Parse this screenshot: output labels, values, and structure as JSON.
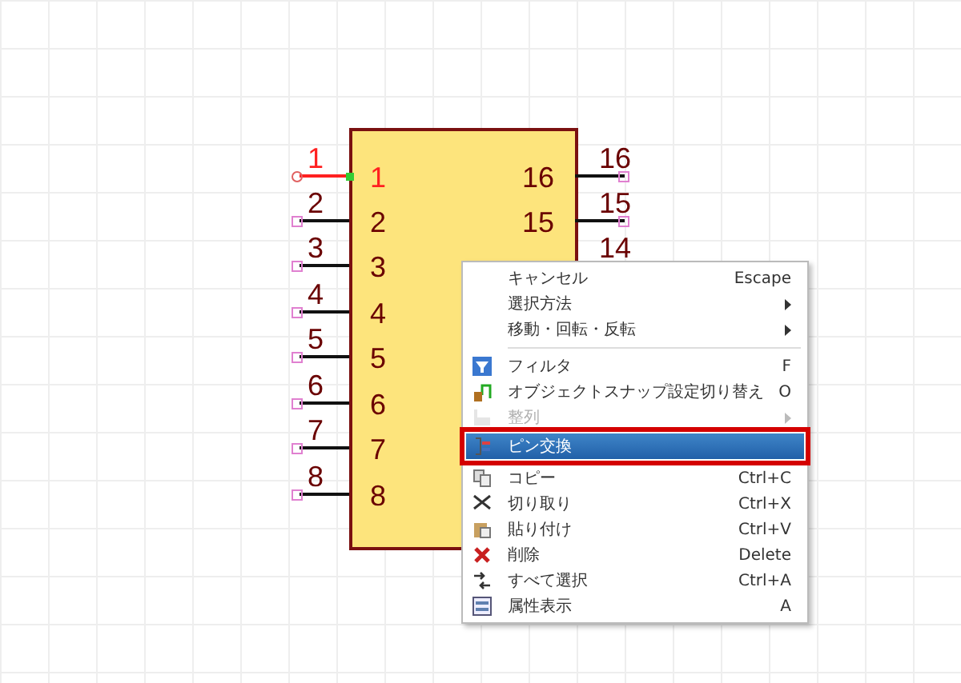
{
  "symbol": {
    "left_pins": [
      {
        "number": "1",
        "label": "1",
        "selected": true
      },
      {
        "number": "2",
        "label": "2",
        "selected": false
      },
      {
        "number": "3",
        "label": "3",
        "selected": false
      },
      {
        "number": "4",
        "label": "4",
        "selected": false
      },
      {
        "number": "5",
        "label": "5",
        "selected": false
      },
      {
        "number": "6",
        "label": "6",
        "selected": false
      },
      {
        "number": "7",
        "label": "7",
        "selected": false
      },
      {
        "number": "8",
        "label": "8",
        "selected": false
      }
    ],
    "right_pins": [
      {
        "number": "16",
        "label": "16"
      },
      {
        "number": "15",
        "label": "15"
      },
      {
        "number": "14"
      }
    ]
  },
  "context_menu": {
    "items": [
      {
        "kind": "item",
        "label": "キャンセル",
        "shortcut": "Escape",
        "submenu": false,
        "disabled": false,
        "selected": false
      },
      {
        "kind": "item",
        "label": "選択方法",
        "submenu": true,
        "disabled": false,
        "selected": false
      },
      {
        "kind": "item",
        "label": "移動・回転・反転",
        "submenu": true,
        "disabled": false,
        "selected": false
      },
      {
        "kind": "separator"
      },
      {
        "kind": "item",
        "label": "フィルタ",
        "shortcut": "F",
        "submenu": false,
        "disabled": false,
        "selected": false
      },
      {
        "kind": "item",
        "label": "オブジェクトスナップ設定切り替え",
        "shortcut": "O",
        "submenu": false,
        "disabled": false,
        "selected": false
      },
      {
        "kind": "item",
        "label": "整列",
        "submenu": true,
        "disabled": true,
        "selected": false
      },
      {
        "kind": "item",
        "label": "ピン交換",
        "submenu": false,
        "disabled": false,
        "selected": true
      },
      {
        "kind": "item",
        "label": "コピー",
        "shortcut": "Ctrl+C",
        "submenu": false,
        "disabled": false,
        "selected": false
      },
      {
        "kind": "item",
        "label": "切り取り",
        "shortcut": "Ctrl+X",
        "submenu": false,
        "disabled": false,
        "selected": false
      },
      {
        "kind": "item",
        "label": "貼り付け",
        "shortcut": "Ctrl+V",
        "submenu": false,
        "disabled": false,
        "selected": false
      },
      {
        "kind": "item",
        "label": "削除",
        "shortcut": "Delete",
        "submenu": false,
        "disabled": false,
        "selected": false
      },
      {
        "kind": "item",
        "label": "すべて選択",
        "shortcut": "Ctrl+A",
        "submenu": false,
        "disabled": false,
        "selected": false
      },
      {
        "kind": "item",
        "label": "属性表示",
        "shortcut": "A",
        "submenu": false,
        "disabled": false,
        "selected": false
      }
    ]
  }
}
